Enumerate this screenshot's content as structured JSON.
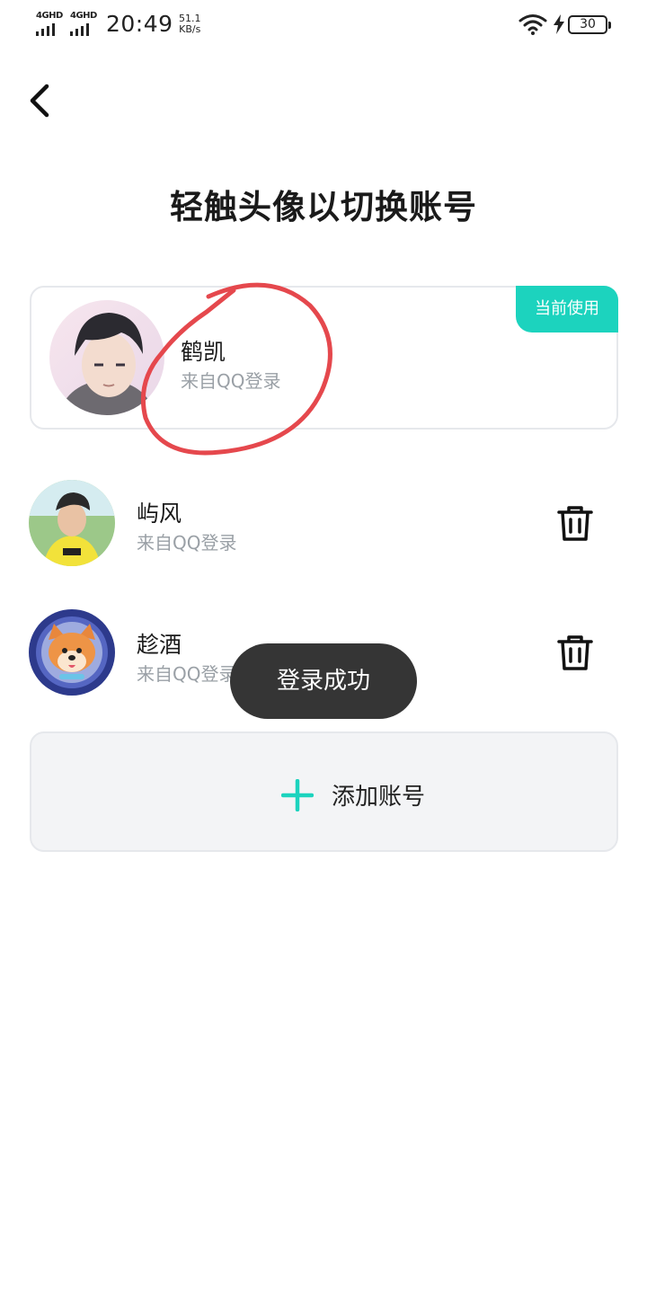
{
  "status_bar": {
    "sim1_network": "4GHD",
    "sim2_network": "4GHD",
    "time": "20:49",
    "net_speed_value": "51.1",
    "net_speed_unit": "KB/s",
    "battery_level": "30",
    "icons": [
      "signal-icon",
      "wifi-icon",
      "charging-icon",
      "battery-icon"
    ]
  },
  "header": {
    "back_icon": "chevron-left-icon",
    "title": "轻触头像以切换账号"
  },
  "current_account": {
    "name": "鹤凯",
    "source": "来自QQ登录",
    "badge": "当前使用"
  },
  "accounts": [
    {
      "name": "屿风",
      "source": "来自QQ登录",
      "action_icon": "trash-icon"
    },
    {
      "name": "趁酒",
      "source": "来自QQ登录",
      "action_icon": "trash-icon"
    }
  ],
  "add_account": {
    "label": "添加账号",
    "icon": "plus-icon"
  },
  "toast": {
    "message": "登录成功"
  },
  "colors": {
    "accent": "#1cd3be",
    "annotation": "#e5484d",
    "toast_bg": "#353535",
    "muted_text": "#9aa0a6",
    "card_bg": "#f3f4f6"
  }
}
